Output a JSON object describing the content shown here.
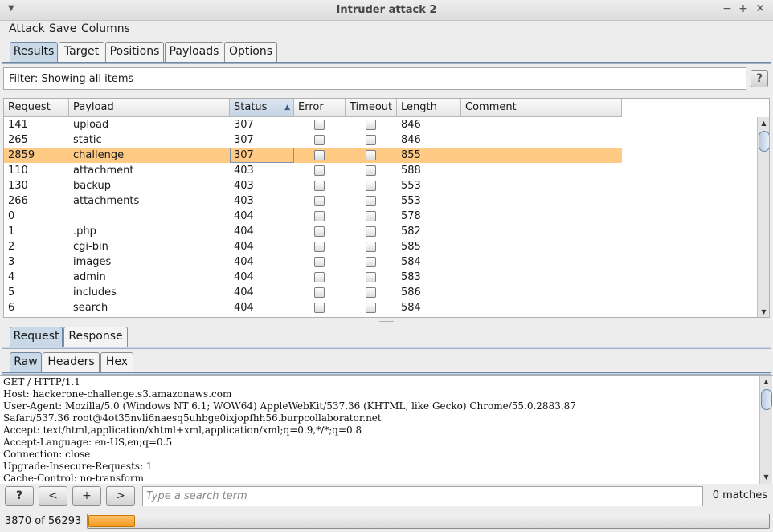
{
  "window": {
    "title": "Intruder attack 2"
  },
  "menu": [
    "Attack",
    "Save",
    "Columns"
  ],
  "main_tabs": [
    "Results",
    "Target",
    "Positions",
    "Payloads",
    "Options"
  ],
  "filter": {
    "text": "Filter: Showing all items",
    "help": "?"
  },
  "table": {
    "columns": [
      "Request",
      "Payload",
      "Status",
      "Error",
      "Timeout",
      "Length",
      "Comment"
    ],
    "rows": [
      {
        "request": "141",
        "payload": "upload",
        "status": "307",
        "length": "846"
      },
      {
        "request": "265",
        "payload": "static",
        "status": "307",
        "length": "846"
      },
      {
        "request": "2859",
        "payload": "challenge",
        "status": "307",
        "length": "855"
      },
      {
        "request": "110",
        "payload": "attachment",
        "status": "403",
        "length": "588"
      },
      {
        "request": "130",
        "payload": "backup",
        "status": "403",
        "length": "553"
      },
      {
        "request": "266",
        "payload": "attachments",
        "status": "403",
        "length": "553"
      },
      {
        "request": "0",
        "payload": "",
        "status": "404",
        "length": "578"
      },
      {
        "request": "1",
        "payload": ".php",
        "status": "404",
        "length": "582"
      },
      {
        "request": "2",
        "payload": "cgi-bin",
        "status": "404",
        "length": "585"
      },
      {
        "request": "3",
        "payload": "images",
        "status": "404",
        "length": "584"
      },
      {
        "request": "4",
        "payload": "admin",
        "status": "404",
        "length": "583"
      },
      {
        "request": "5",
        "payload": "includes",
        "status": "404",
        "length": "586"
      },
      {
        "request": "6",
        "payload": "search",
        "status": "404",
        "length": "584"
      }
    ]
  },
  "detail_tabs": [
    "Request",
    "Response"
  ],
  "view_tabs": [
    "Raw",
    "Headers",
    "Hex"
  ],
  "raw_lines": [
    "GET / HTTP/1.1",
    "Host: hackerone-challenge.s3.amazonaws.com",
    "User-Agent: Mozilla/5.0 (Windows NT 6.1; WOW64) AppleWebKit/537.36 (KHTML, like Gecko) Chrome/55.0.2883.87",
    "Safari/537.36 root@4ot35nvli6naesq5uhbge0ixjopfhh56.burpcollaborator.net",
    "Accept: text/html,application/xhtml+xml,application/xml;q=0.9,*/*;q=0.8",
    "Accept-Language: en-US,en;q=0.5",
    "Connection: close",
    "Upgrade-Insecure-Requests: 1",
    "Cache-Control: no-transform"
  ],
  "search": {
    "help": "?",
    "prev": "<",
    "add": "+",
    "next": ">",
    "placeholder": "Type a search term",
    "matches": "0 matches"
  },
  "status": {
    "progress_text": "3870 of 56293",
    "done": 3870,
    "total": 56293
  }
}
